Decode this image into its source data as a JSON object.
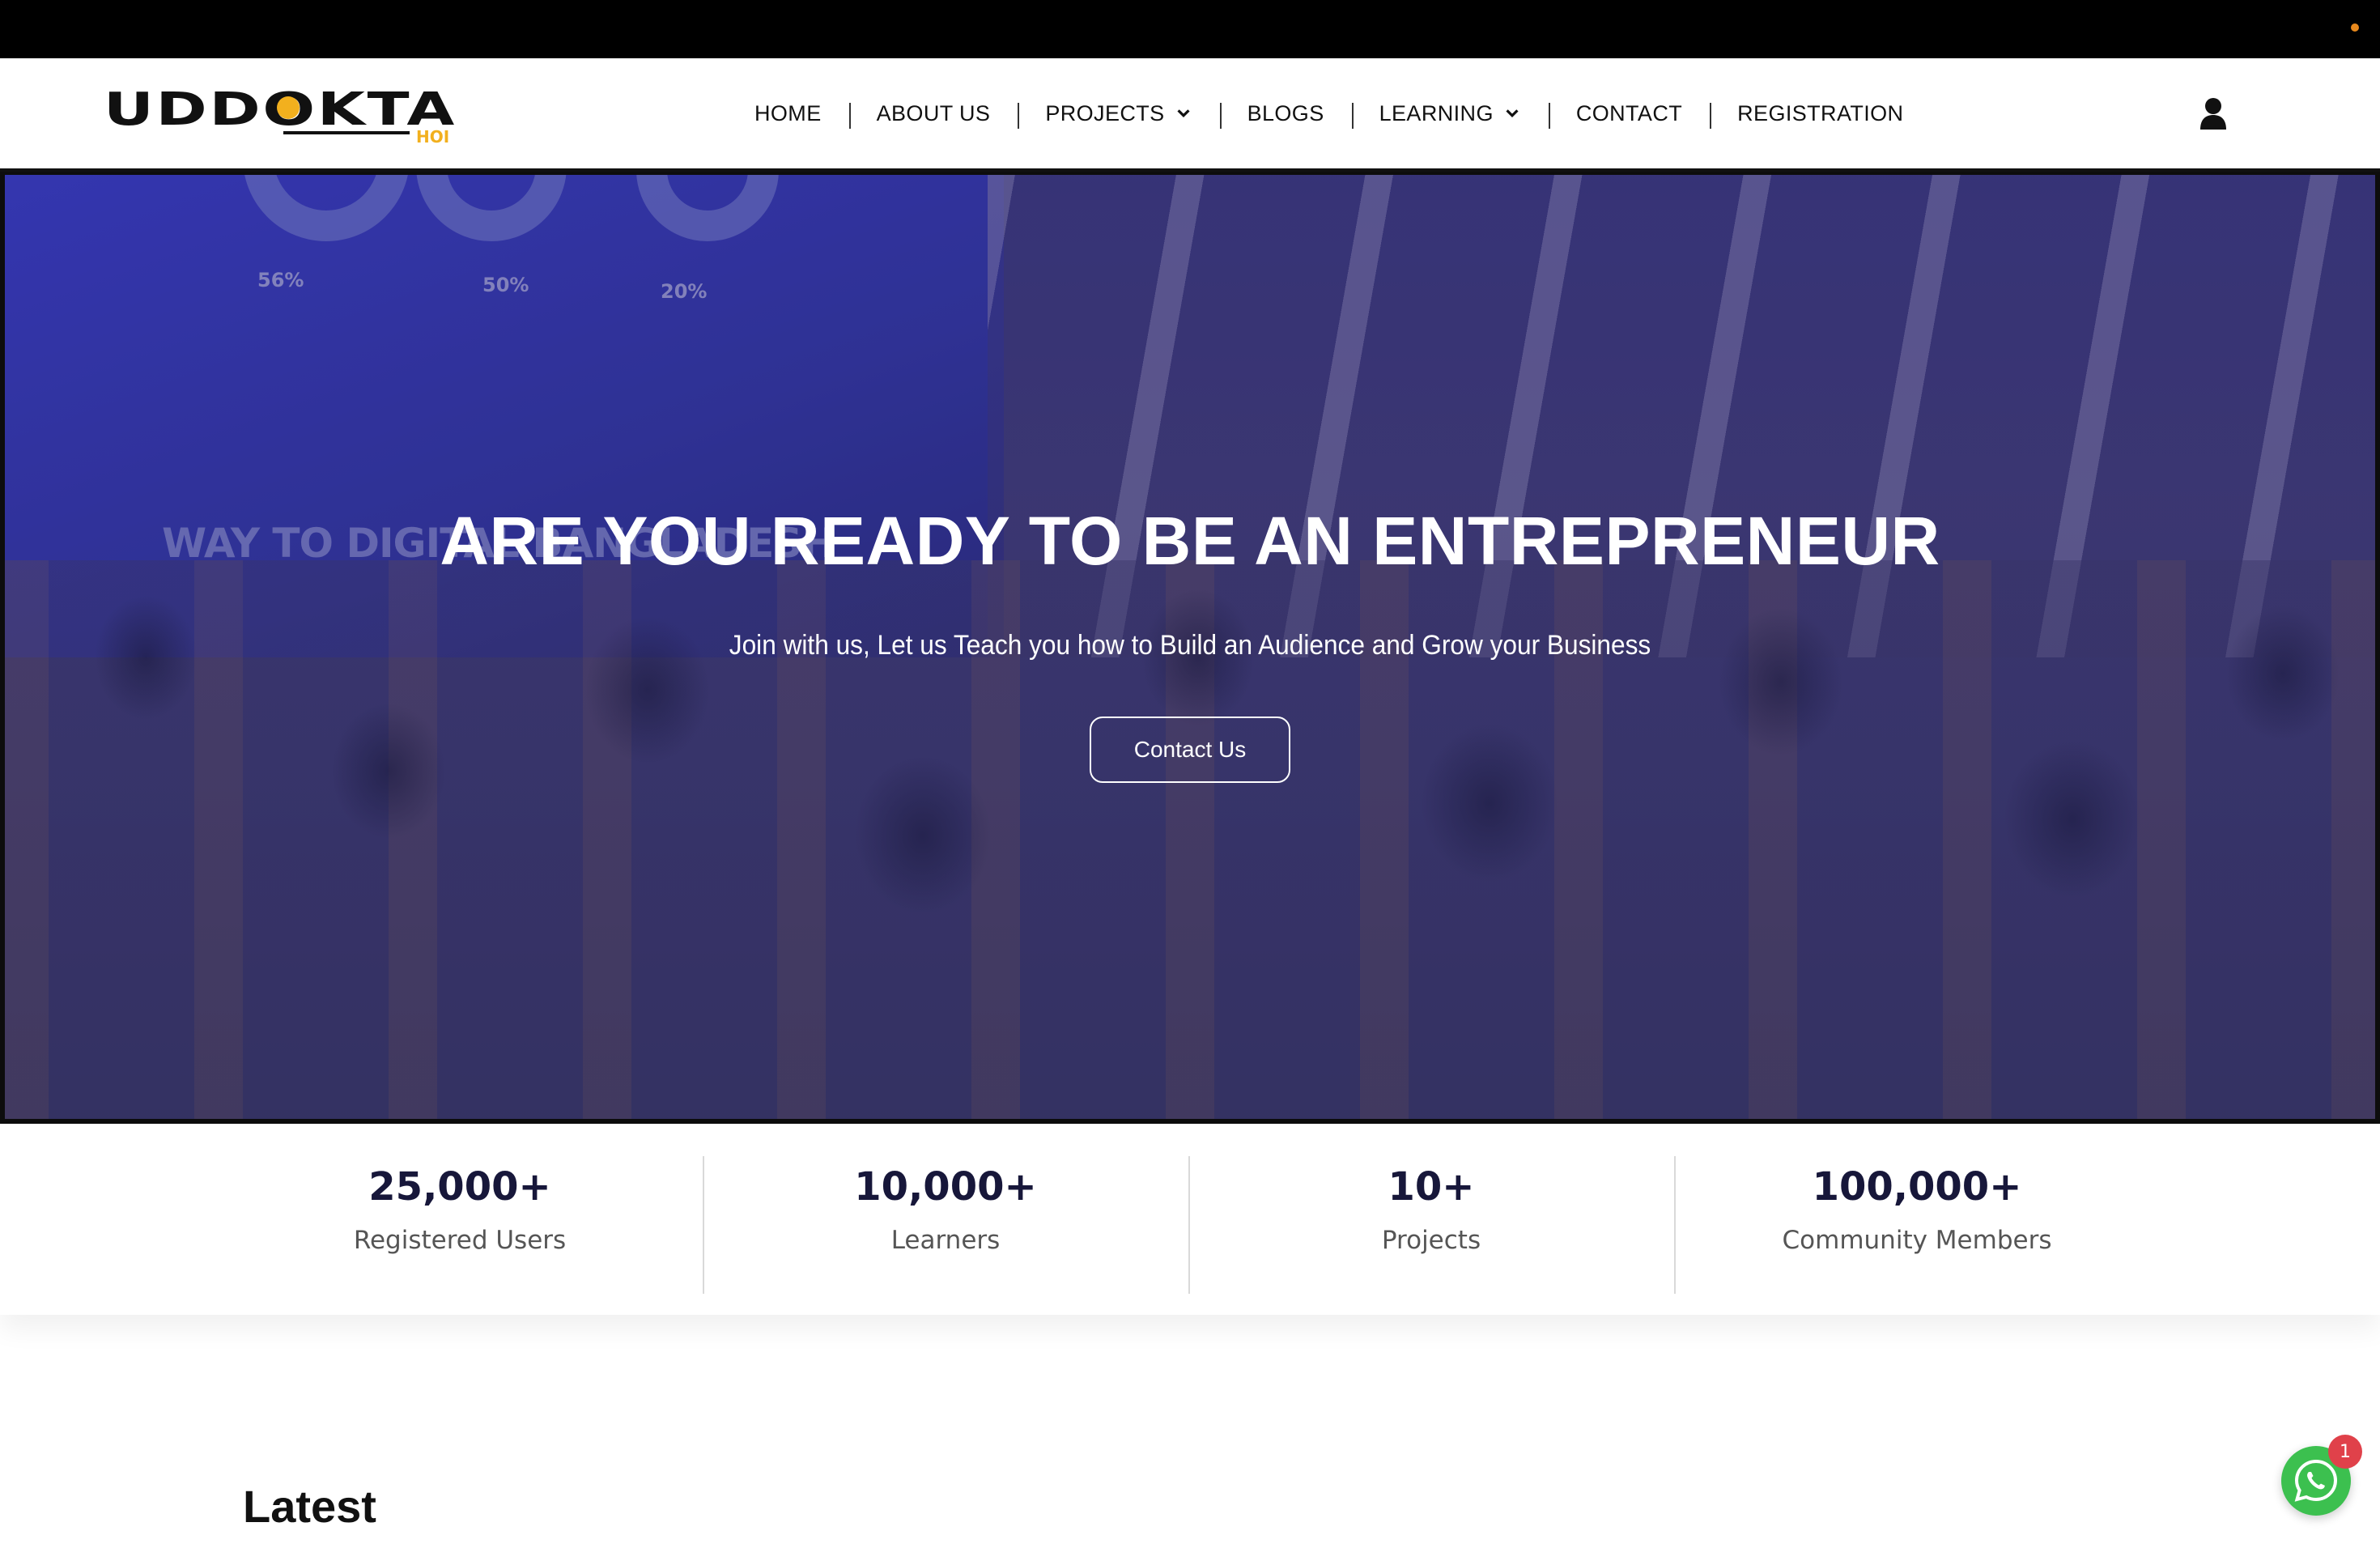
{
  "brand": {
    "logo_text": "UDDOKTA",
    "logo_sub": "HOI"
  },
  "nav": [
    {
      "label": "HOME",
      "dropdown": false
    },
    {
      "label": "ABOUT US",
      "dropdown": false
    },
    {
      "label": "PROJECTS",
      "dropdown": true
    },
    {
      "label": "BLOGS",
      "dropdown": false
    },
    {
      "label": "LEARNING",
      "dropdown": true
    },
    {
      "label": "CONTACT",
      "dropdown": false
    },
    {
      "label": "REGISTRATION",
      "dropdown": false
    }
  ],
  "hero": {
    "title": "ARE YOU READY TO BE AN ENTREPRENEUR",
    "subtitle": "Join with us, Let us Teach you how to Build an Audience and Grow your Business",
    "button": "Contact Us",
    "photo_text": {
      "headline": "WAY TO DIGITAL BANGLADESH",
      "stats": [
        "56%",
        "50%",
        "20%"
      ]
    }
  },
  "stats": [
    {
      "value": "25,000+",
      "label": "Registered Users"
    },
    {
      "value": "10,000+",
      "label": "Learners"
    },
    {
      "value": "10+",
      "label": "Projects"
    },
    {
      "value": "100,000+",
      "label": "Community Members"
    }
  ],
  "latest_heading": "Latest",
  "whatsapp": {
    "badge": "1"
  },
  "colors": {
    "accent": "#f2b01e",
    "header_bg": "#ffffff",
    "topbar": "#000000",
    "stat_number": "#17173a",
    "whatsapp": "#3cc04f",
    "badge": "#e0414a"
  }
}
